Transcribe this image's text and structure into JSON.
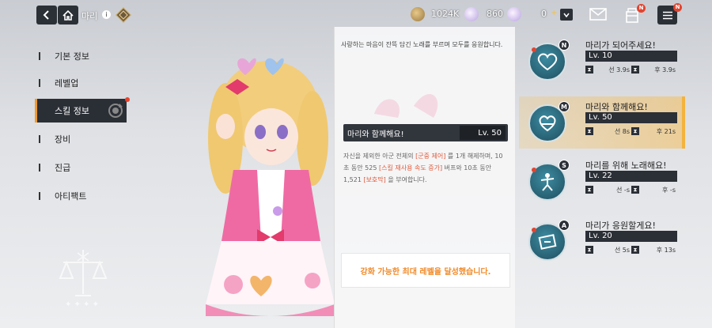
{
  "header": {
    "character_name": "마리",
    "info_icon": "info-icon",
    "coins": "1024K",
    "gems": "860",
    "extra_count": "0"
  },
  "nav": {
    "items": [
      {
        "label": "기본 정보",
        "active": false
      },
      {
        "label": "레벨업",
        "active": false
      },
      {
        "label": "스킬 정보",
        "active": true
      },
      {
        "label": "장비",
        "active": false
      },
      {
        "label": "진급",
        "active": false
      },
      {
        "label": "아티팩트",
        "active": false
      }
    ]
  },
  "detail": {
    "description": "사랑하는 마음이 잔뜩 담긴 노래를 부르며 모두를 응원합니다.",
    "skill_name": "마리와 함께해요!",
    "skill_level": "Lv. 50",
    "effect_parts": [
      {
        "text": "자신을 제외한 아군 전체의 ",
        "hl": false
      },
      {
        "text": "[군중 제어]",
        "hl": true
      },
      {
        "text": " 를 1개 해제하며, 10초 동안 525 ",
        "hl": false
      },
      {
        "text": "[스킬 재사용 속도 증가]",
        "hl": true
      },
      {
        "text": " 버프와 10초 동안 1,521 ",
        "hl": false
      },
      {
        "text": "[보호막]",
        "hl": true
      },
      {
        "text": " 을 부여합니다.",
        "hl": false
      }
    ],
    "max_level_text": "강화 가능한 최대 레벨을 달성했습니다."
  },
  "skills": [
    {
      "badge": "N",
      "name": "마리가 되어주세요!",
      "level": "Lv. 10",
      "cd_first": "선 3.9s",
      "cd_after": "후 3.9s",
      "dot": true,
      "active": false
    },
    {
      "badge": "M",
      "name": "마리와 함께해요!",
      "level": "Lv. 50",
      "cd_first": "선 8s",
      "cd_after": "후 21s",
      "dot": false,
      "active": true
    },
    {
      "badge": "S",
      "name": "마리를 위해 노래해요!",
      "level": "Lv. 22",
      "cd_first": "선 -s",
      "cd_after": "후 -s",
      "dot": true,
      "active": false
    },
    {
      "badge": "A",
      "name": "마리가 응원할게요!",
      "level": "Lv. 20",
      "cd_first": "선 5s",
      "cd_after": "후 13s",
      "dot": true,
      "active": false
    }
  ],
  "badges": {
    "notification": "N"
  },
  "colors": {
    "accent": "#f39a2a",
    "highlight": "#e05a3a",
    "dark": "#2b2f36",
    "active_card": "#f3b33d"
  }
}
